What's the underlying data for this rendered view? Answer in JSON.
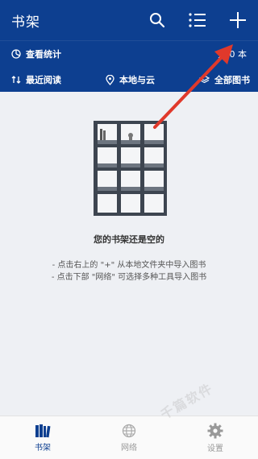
{
  "header": {
    "title": "书架",
    "accent": "#0d3f90",
    "icons": [
      "search-icon",
      "list-icon",
      "add-icon"
    ]
  },
  "subbar": {
    "stats_label": "查看统计",
    "count_label": "共 0 本",
    "sort_label": "最近阅读",
    "location_label": "本地与云",
    "filter_label": "全部图书"
  },
  "empty": {
    "title": "您的书架还是空的",
    "hint1": "- 点击右上的 \"+\" 从本地文件夹中导入图书",
    "hint2": "- 点击下部 \"网络\" 可选择多种工具导入图书"
  },
  "bottom_nav": {
    "tabs": [
      {
        "label": "书架",
        "icon": "bookshelf-icon",
        "active": true
      },
      {
        "label": "网络",
        "icon": "globe-icon",
        "active": false
      },
      {
        "label": "设置",
        "icon": "gear-icon",
        "active": false
      }
    ]
  },
  "watermark": "千篇软件"
}
